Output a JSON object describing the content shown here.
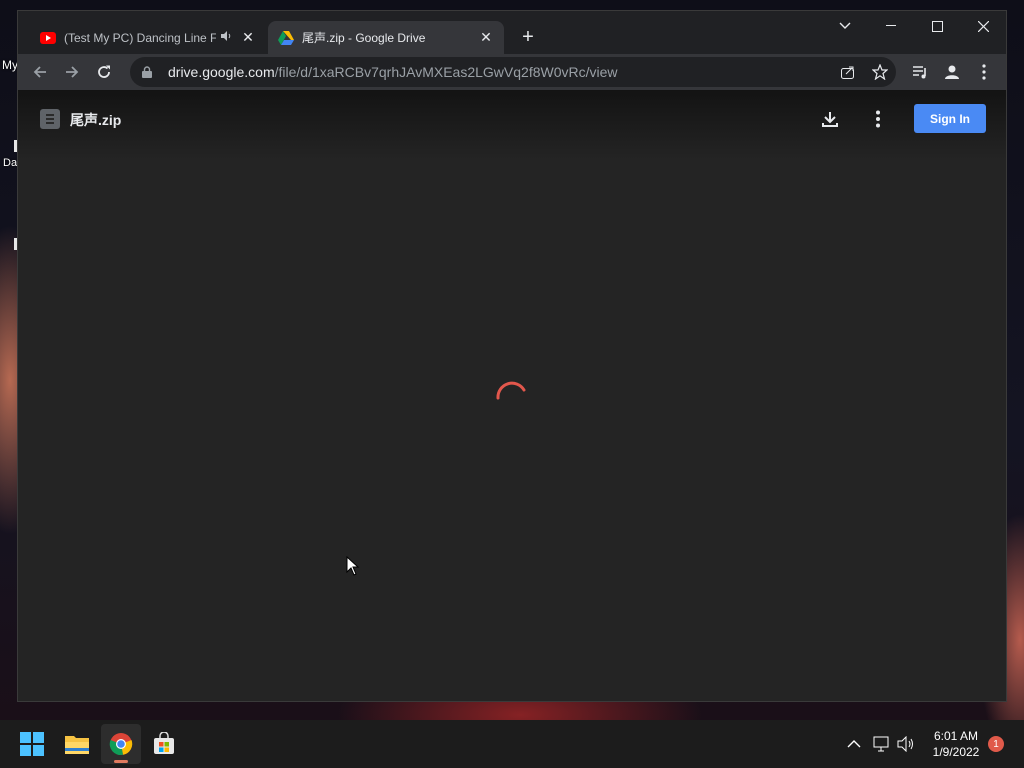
{
  "desktop": {
    "icon_labels": [
      "My",
      "Da"
    ]
  },
  "browser": {
    "tabs": [
      {
        "title": "(Test My PC) Dancing Line Fa",
        "favicon": "youtube-icon",
        "audio": true,
        "active": false
      },
      {
        "title": "尾声.zip - Google Drive",
        "favicon": "google-drive-icon",
        "audio": false,
        "active": true
      }
    ],
    "new_tab_label": "+",
    "address_bar": {
      "host": "drive.google.com",
      "path": "/file/d/1xaRCBv7qrhJAvMXEas2LGwVq2f8W0vRc/view"
    }
  },
  "drive_viewer": {
    "file_name": "尾声.zip",
    "sign_in_label": "Sign In",
    "loading": true,
    "spinner_color": "#e2574c",
    "accent_color": "#4a8af4"
  },
  "taskbar": {
    "apps": [
      "windows-start-icon",
      "file-explorer-icon",
      "chrome-icon",
      "microsoft-store-icon"
    ],
    "clock_time": "6:01 AM",
    "clock_date": "1/9/2022",
    "notification_count": "1"
  }
}
